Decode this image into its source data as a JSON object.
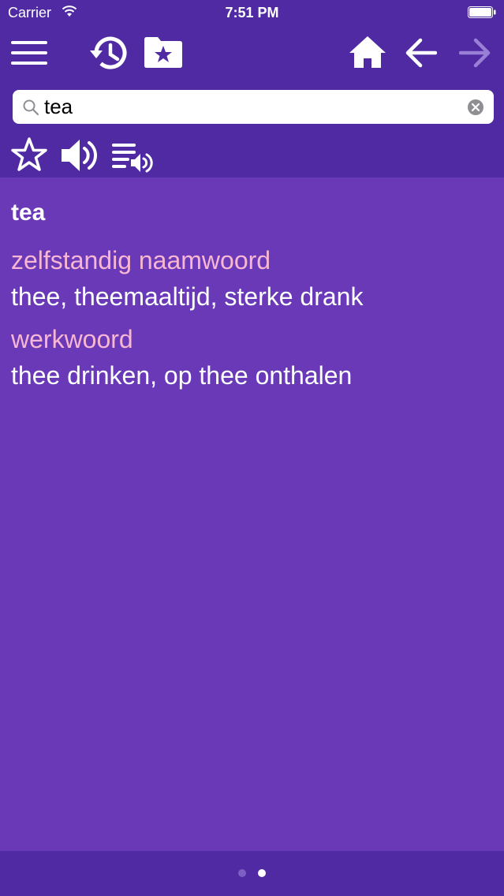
{
  "status_bar": {
    "carrier": "Carrier",
    "time": "7:51 PM"
  },
  "toolbar": {
    "icons": [
      "menu-icon",
      "history-icon",
      "favorites-folder-icon",
      "home-icon",
      "back-arrow-icon",
      "forward-arrow-icon"
    ]
  },
  "search": {
    "value": "tea",
    "placeholder": ""
  },
  "actions": {
    "icons": [
      "star-icon",
      "speaker-icon",
      "playlist-audio-icon"
    ]
  },
  "entry": {
    "headword": "tea",
    "senses": [
      {
        "pos": "zelfstandig naamwoord",
        "translation": "thee, theemaaltijd, sterke drank"
      },
      {
        "pos": "werkwoord",
        "translation": "thee drinken, op thee onthalen"
      }
    ]
  },
  "pager": {
    "pages": 2,
    "current": 2
  },
  "colors": {
    "header_bg": "#4f2aa3",
    "content_bg": "#6a39b8",
    "pos_text": "#f7b6d2",
    "text": "#ffffff"
  }
}
